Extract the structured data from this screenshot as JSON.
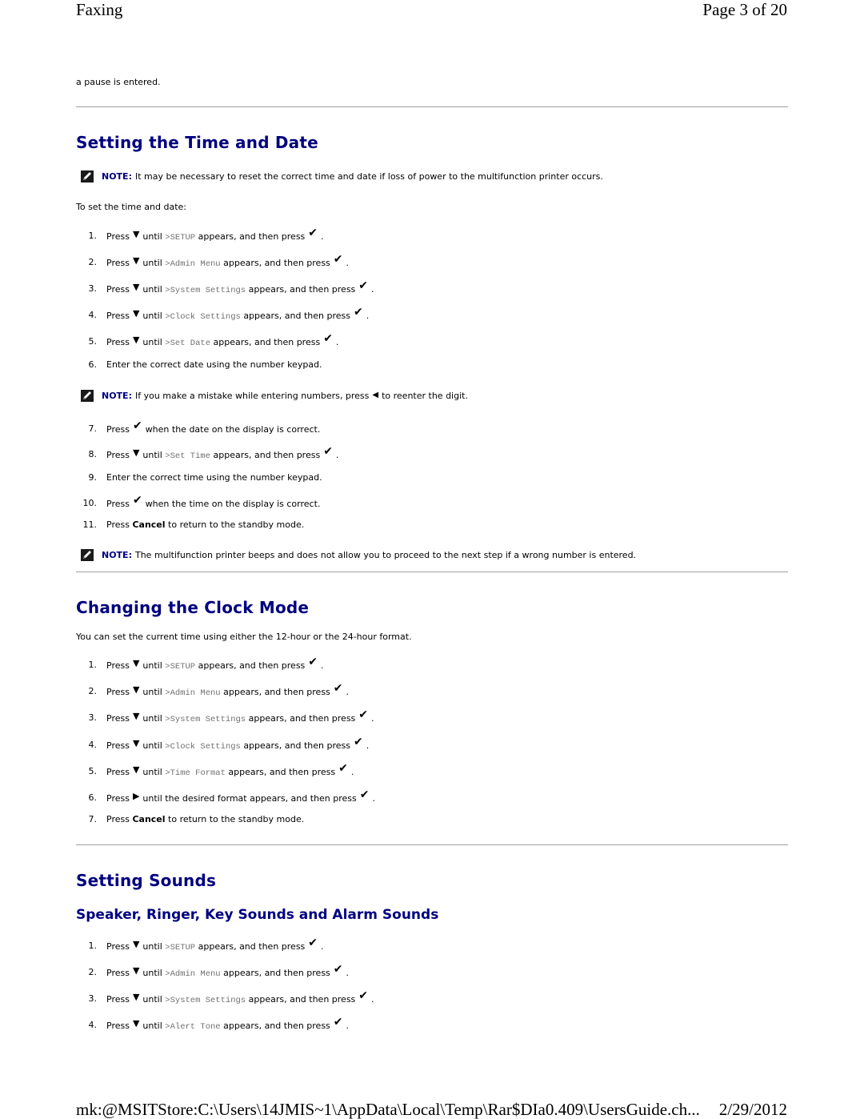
{
  "header": {
    "title": "Faxing",
    "page": "Page 3 of 20"
  },
  "footer": {
    "path": "mk:@MSITStore:C:\\Users\\14JMIS~1\\AppData\\Local\\Temp\\Rar$DIa0.409\\UsersGuide.ch...",
    "date": "2/29/2012"
  },
  "intro_fragment": "a pause is entered.",
  "colors": {
    "heading": "#000080",
    "note_label": "#000080",
    "menu_text": "#707070",
    "rule": "#a0a0a0"
  },
  "icons": {
    "down": "down-arrow-icon",
    "check": "checkmark-icon",
    "left": "left-arrow-icon",
    "right": "right-arrow-icon",
    "note": "pencil-note-icon"
  },
  "common": {
    "press": "Press",
    "until": "until",
    "appears_then_press": "appears, and then press",
    "period": ".",
    "note_label": "NOTE:"
  },
  "section_time_date": {
    "title": "Setting the Time and Date",
    "note1": "It may be necessary to reset the correct time and date if loss of power to the multifunction printer occurs.",
    "lead": "To set the time and date:",
    "steps": [
      {
        "n": "1.",
        "menu": ">SETUP"
      },
      {
        "n": "2.",
        "menu": ">Admin Menu"
      },
      {
        "n": "3.",
        "menu": ">System Settings"
      },
      {
        "n": "4.",
        "menu": ">Clock Settings"
      },
      {
        "n": "5.",
        "menu": ">Set Date"
      },
      {
        "n": "6.",
        "text": "Enter the correct date using the number keypad."
      },
      {
        "n": "7.",
        "text": "when the date on the display is correct."
      },
      {
        "n": "8.",
        "menu": ">Set Time"
      },
      {
        "n": "9.",
        "text": "Enter the correct time using the number keypad."
      },
      {
        "n": "10.",
        "text": "when the time on the display is correct."
      },
      {
        "n": "11.",
        "bold": "Cancel",
        "text": "to return to the standby mode."
      }
    ],
    "note2_a": "If you make a mistake while entering numbers, press",
    "note2_b": "to reenter the digit.",
    "note3": "The multifunction printer beeps and does not allow you to proceed to the next step if a wrong number is entered."
  },
  "section_clock_mode": {
    "title": "Changing the Clock Mode",
    "lead": "You can set the current time using either the 12-hour or the 24-hour format.",
    "steps": [
      {
        "n": "1.",
        "menu": ">SETUP"
      },
      {
        "n": "2.",
        "menu": ">Admin Menu"
      },
      {
        "n": "3.",
        "menu": ">System Settings"
      },
      {
        "n": "4.",
        "menu": ">Clock Settings"
      },
      {
        "n": "5.",
        "menu": ">Time Format"
      },
      {
        "n": "6.",
        "text": "until the desired format appears, and then press"
      },
      {
        "n": "7.",
        "bold": "Cancel",
        "text": "to return to the standby mode."
      }
    ]
  },
  "section_sounds": {
    "title": "Setting Sounds",
    "subtitle": "Speaker, Ringer, Key Sounds and Alarm Sounds",
    "steps": [
      {
        "n": "1.",
        "menu": ">SETUP"
      },
      {
        "n": "2.",
        "menu": ">Admin Menu"
      },
      {
        "n": "3.",
        "menu": ">System Settings"
      },
      {
        "n": "4.",
        "menu": ">Alert Tone"
      }
    ]
  }
}
